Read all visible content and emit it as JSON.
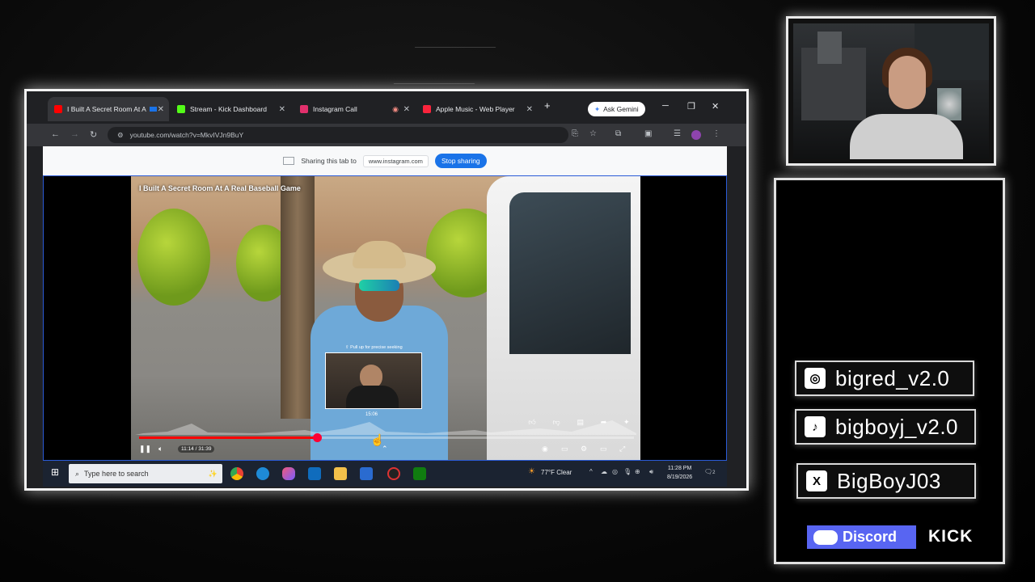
{
  "browser": {
    "tabs": [
      {
        "title": "I Built A Secret Room At A",
        "favicon_color": "#ff0000",
        "active": true
      },
      {
        "title": "Stream - Kick Dashboard",
        "favicon_color": "#53fc18",
        "active": false
      },
      {
        "title": "Instagram Call",
        "favicon_color": "#e1306c",
        "active": false
      },
      {
        "title": "Apple Music - Web Player",
        "favicon_color": "#fa243c",
        "active": false
      }
    ],
    "new_tab": "+",
    "gemini_label": "Ask Gemini",
    "url": "youtube.com/watch?v=MkvIVJn9BuY",
    "share_text": "Sharing this tab to",
    "share_host": "www.instagram.com",
    "stop_sharing": "Stop sharing"
  },
  "video": {
    "title": "I Built A Secret Room At A Real Baseball Game",
    "preview_hint": "⇧ Pull up for precise seeking",
    "preview_time": "15:06",
    "timecode": "11:14 / 31:39",
    "progress": 0.36
  },
  "taskbar": {
    "search_placeholder": "Type here to search",
    "weather": "77°F  Clear",
    "time": "11:28 PM",
    "date": "8/19/2026",
    "notif_count": "2"
  },
  "socials": {
    "instagram": "bigred_v2.0",
    "tiktok": "bigboyj_v2.0",
    "x": "BigBoyJ03",
    "discord": "Discord",
    "kick": "KICK"
  },
  "colors": {
    "accent": "#1a73e8",
    "progress": "#ff0000",
    "discord": "#5865f2"
  }
}
